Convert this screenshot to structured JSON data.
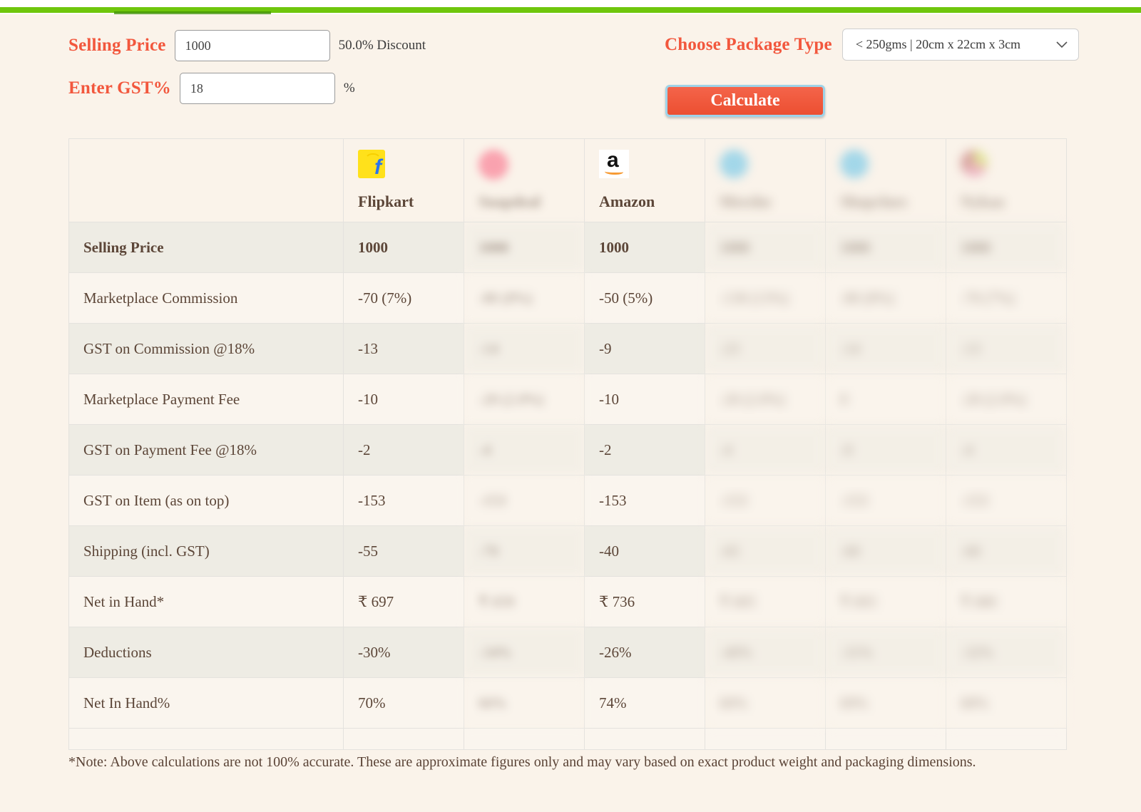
{
  "theme": {
    "accent": "#f2573d",
    "page_bg": "#faf3ea",
    "topbar_green": "#6fc60c",
    "text_brown": "#5c4638"
  },
  "form": {
    "selling_price_label": "Selling Price",
    "selling_price_value": "1000",
    "selling_price_placeholder": "Selling Price",
    "discount_text": "50.0% Discount",
    "gst_label": "Enter GST%",
    "gst_value": "18",
    "gst_placeholder": "GST %",
    "gst_suffix": "%",
    "package_label": "Choose Package Type",
    "package_selected": "< 250gms | 20cm x 22cm x 3cm",
    "calculate_label": "Calculate"
  },
  "table": {
    "columns": [
      {
        "name": "Flipkart",
        "logo": "flipkart-logo",
        "obscured": false
      },
      {
        "name": "Snapdeal",
        "logo": "pink-circle-logo",
        "obscured": true
      },
      {
        "name": "Amazon",
        "logo": "amazon-logo",
        "obscured": false
      },
      {
        "name": "Meesho",
        "logo": "blue-circle-logo",
        "obscured": true
      },
      {
        "name": "Shopclues",
        "logo": "blue-circle-logo",
        "obscured": true
      },
      {
        "name": "Nykaa",
        "logo": "multicolor-circle-logo",
        "obscured": true
      }
    ],
    "rows": [
      {
        "label": "Selling Price",
        "style": "bold",
        "values": [
          "1000",
          "1000",
          "1000",
          "1000",
          "1000",
          "1000"
        ]
      },
      {
        "label": "Marketplace Commission",
        "style": "normal",
        "values": [
          "-70 (7%)",
          "-80 (8%)",
          "-50 (5%)",
          "-130 (13%)",
          "-80 (8%)",
          "-70 (7%)"
        ]
      },
      {
        "label": "GST on Commission @18%",
        "style": "normal",
        "values": [
          "-13",
          "-14",
          "-9",
          "-23",
          "-14",
          "-13"
        ]
      },
      {
        "label": "Marketplace Payment Fee",
        "style": "normal",
        "values": [
          "-10",
          "-20 (2.0%)",
          "-10",
          "-20 (2.0%)",
          "0",
          "-20 (2.0%)"
        ]
      },
      {
        "label": "GST on Payment Fee @18%",
        "style": "normal",
        "values": [
          "-2",
          "-4",
          "-2",
          "-4",
          "-0",
          "-4"
        ]
      },
      {
        "label": "GST on Item (as on top)",
        "style": "normal",
        "values": [
          "-153",
          "-153",
          "-153",
          "-153",
          "-153",
          "-153"
        ]
      },
      {
        "label": "Shipping (incl. GST)",
        "style": "normal",
        "values": [
          "-55",
          "-70",
          "-40",
          "-65",
          "-60",
          "-60"
        ]
      },
      {
        "label": "Net in Hand*",
        "style": "accent",
        "values": [
          "₹ 697",
          "₹ 659",
          "₹ 736",
          "₹ 605",
          "₹ 693",
          "₹ 680"
        ]
      },
      {
        "label": "Deductions",
        "style": "normal",
        "values": [
          "-30%",
          "-34%",
          "-26%",
          "-40%",
          "-31%",
          "-32%"
        ]
      },
      {
        "label": "Net In Hand%",
        "style": "accent",
        "values": [
          "70%",
          "66%",
          "74%",
          "60%",
          "69%",
          "68%"
        ]
      }
    ]
  },
  "note": "*Note: Above calculations are not 100% accurate. These are approximate figures only and may vary based on exact product weight and packaging dimensions."
}
